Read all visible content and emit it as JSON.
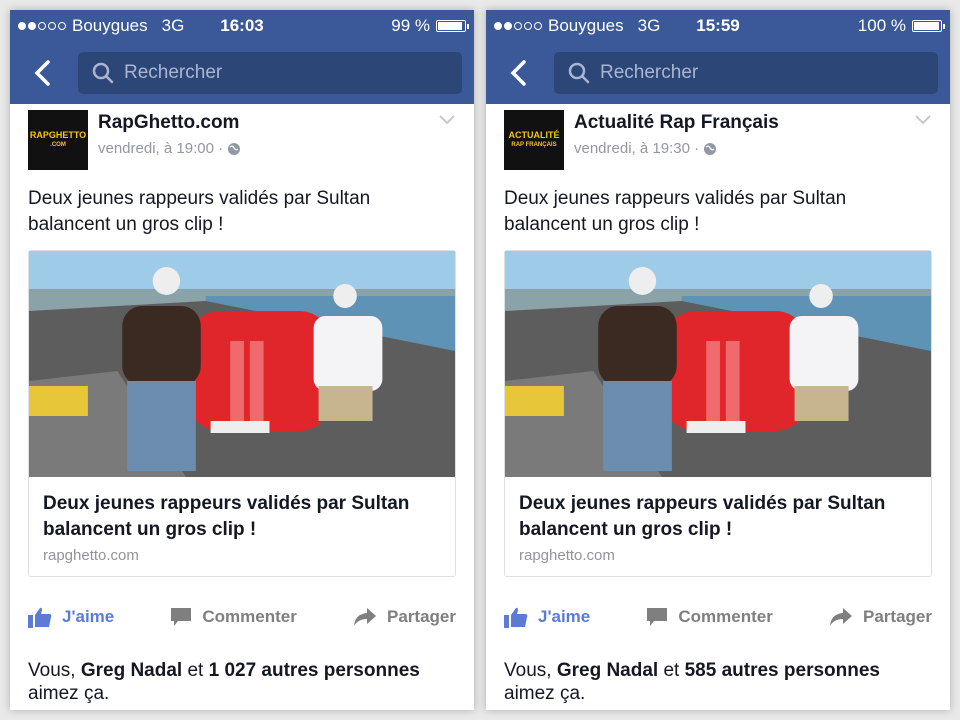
{
  "screens": [
    {
      "status": {
        "carrier": "Bouygues",
        "network": "3G",
        "time": "16:03",
        "battery": "99 %",
        "battery_level": 0.99
      },
      "search_placeholder": "Rechercher",
      "post": {
        "page_name": "RapGhetto.com",
        "logo_text": "RAPGHETTO",
        "logo_sub": ".COM",
        "date": "vendredi, à 19:00 ·",
        "caption": "Deux jeunes rappeurs validés par Sultan balancent un gros clip !",
        "link_title": "Deux jeunes rappeurs validés par Sultan balancent un gros clip !",
        "link_domain": "rapghetto.com"
      },
      "actions": {
        "like": "J'aime",
        "comment": "Commenter",
        "share": "Partager"
      },
      "likes": {
        "prefix": "Vous, ",
        "friend": "Greg Nadal",
        "middle": " et ",
        "count": "1 027 autres personnes",
        "suffix": "aimez ça."
      }
    },
    {
      "status": {
        "carrier": "Bouygues",
        "network": "3G",
        "time": "15:59",
        "battery": "100 %",
        "battery_level": 1.0
      },
      "search_placeholder": "Rechercher",
      "post": {
        "page_name": "Actualité Rap Français",
        "logo_text": "ACTUALITÉ",
        "logo_sub": "RAP FRANÇAIS",
        "date": "vendredi, à 19:30 ·",
        "caption": "Deux jeunes rappeurs validés par Sultan balancent un gros clip !",
        "link_title": "Deux jeunes rappeurs validés par Sultan balancent un gros clip !",
        "link_domain": "rapghetto.com"
      },
      "actions": {
        "like": "J'aime",
        "comment": "Commenter",
        "share": "Partager"
      },
      "likes": {
        "prefix": "Vous, ",
        "friend": "Greg Nadal",
        "middle": " et ",
        "count": "585 autres personnes",
        "suffix": "aimez ça."
      }
    }
  ],
  "colors": {
    "facebook_blue": "#3b5998",
    "search_bg": "#2d4678",
    "like_blue": "#5b7bd5"
  }
}
